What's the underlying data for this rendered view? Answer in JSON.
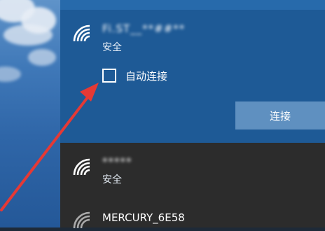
{
  "wifi_flyout": {
    "selected_network": {
      "name": "Fi.ST__**##**",
      "status": "安全",
      "auto_connect_label": "自动连接",
      "auto_connect_checked": false,
      "connect_label": "连接"
    },
    "networks": [
      {
        "name": "*****",
        "status": "安全"
      },
      {
        "name": "MERCURY_6E58",
        "status": ""
      }
    ]
  },
  "annotation": {
    "color": "#e53935"
  },
  "colors": {
    "selected_bg": "#1e5a96",
    "list_bg": "#2c2c2c",
    "button_bg": "#5f90c0"
  }
}
